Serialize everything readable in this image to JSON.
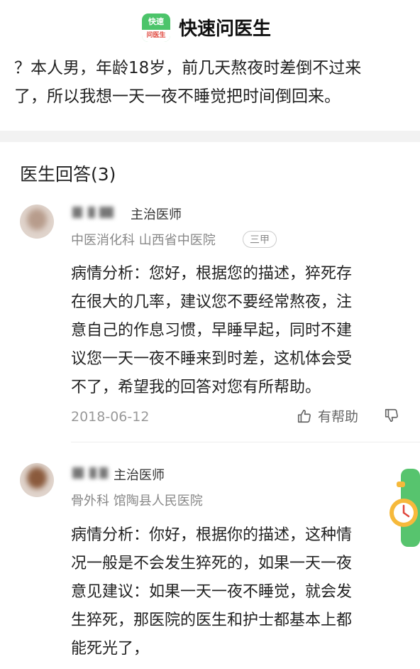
{
  "header": {
    "logo_top": "快速",
    "logo_bottom": "问医生",
    "brand": "快速问医生"
  },
  "question": {
    "line1": "？本人男，年龄18岁，前几天熬夜时差倒不过来",
    "line2": "了，所以我想一天一夜不睡觉把时间倒回来。"
  },
  "answers_title": "医生回答(3)",
  "answers": [
    {
      "title": "主治医师",
      "dept": "中医消化科 山西省中医院",
      "badge": "三甲",
      "lines": [
        "病情分析：您好，根据您的描述，猝死存",
        "在很大的几率，建议您不要经常熬夜，注",
        "意自己的作息习惯，早睡早起，同时不建",
        "议您一天一夜不睡来到时差，这机体会受",
        "不了，希望我的回答对您有所帮助。"
      ],
      "date": "2018-06-12",
      "helpful": "有帮助"
    },
    {
      "title": "主治医师",
      "dept": "骨外科 馆陶县人民医院",
      "lines": [
        "病情分析：你好，根据你的描述，这种情",
        "况一般是不会发生猝死的，如果一天一夜",
        "意见建议：如果一天一夜不睡觉，就会发",
        "生猝死，那医院的医生和护士都基本上都",
        "能死光了，"
      ]
    }
  ]
}
